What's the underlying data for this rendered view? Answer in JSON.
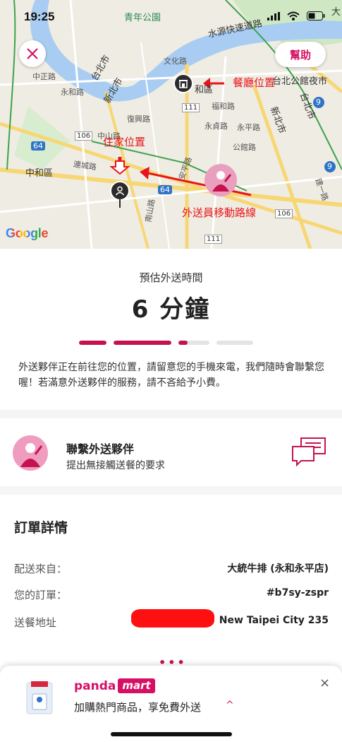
{
  "status_bar": {
    "time": "19:25"
  },
  "map": {
    "labels": {
      "park": "青年公園",
      "expressway": "水源快速道路",
      "taipei_left": "台北市",
      "newtaipei_left": "新北市",
      "district": "中和區",
      "taipei_right": "台北市",
      "newtaipei_right": "新北市",
      "nightmarket": "台北公館夜市",
      "road_wenhua": "文化路",
      "road_fuhe": "福和路",
      "road_yonghe": "永貞路",
      "road_zhongshan": "中山路",
      "road_liancheng": "連城路",
      "road_anping": "安平路",
      "road_nanshan": "南山路",
      "road_yongping": "永平路",
      "road_chongxin": "永和路",
      "he_label": "和區",
      "tr_corner": "大",
      "route_111": "111",
      "route_106": "106",
      "route_64": "64",
      "route_9": "9",
      "road_zhongzheng": "中正路",
      "road_xinsheng": "公館路",
      "road_jianyi": "建一路",
      "road_fuxing": "復興路"
    },
    "annotations": {
      "restaurant": "餐廳位置",
      "home": "住家位置",
      "route": "外送員移動路線"
    },
    "google": "Google",
    "help_label": "幫助"
  },
  "eta": {
    "label": "預估外送時間",
    "value": "6 分鐘",
    "progress": [
      1.0,
      1.0,
      0.3,
      0.0
    ],
    "message": "外送夥伴正在前往您的位置，請留意您的手機來電，我們隨時會聯繫您喔！若滿意外送夥伴的服務，請不吝給予小費。"
  },
  "contact": {
    "title": "聯繫外送夥伴",
    "subtitle": "提出無接觸送餐的要求"
  },
  "order": {
    "title": "訂單詳情",
    "rows": [
      {
        "key": "配送來自：",
        "value": "大統牛排 (永和永平店)"
      },
      {
        "key": "您的訂單：",
        "value": "#b7sy-zspr"
      },
      {
        "key": "送餐地址",
        "value": "New Taipei City 235"
      }
    ],
    "more": "•••"
  },
  "sheet": {
    "brand_panda": "panda",
    "brand_mart": "mart",
    "promo": "加購熱門商品，享免費外送",
    "chevron": "^",
    "close": "×"
  },
  "colors": {
    "brand": "#d70f64",
    "progress": "#c5124f",
    "annotation": "#e8141b"
  }
}
